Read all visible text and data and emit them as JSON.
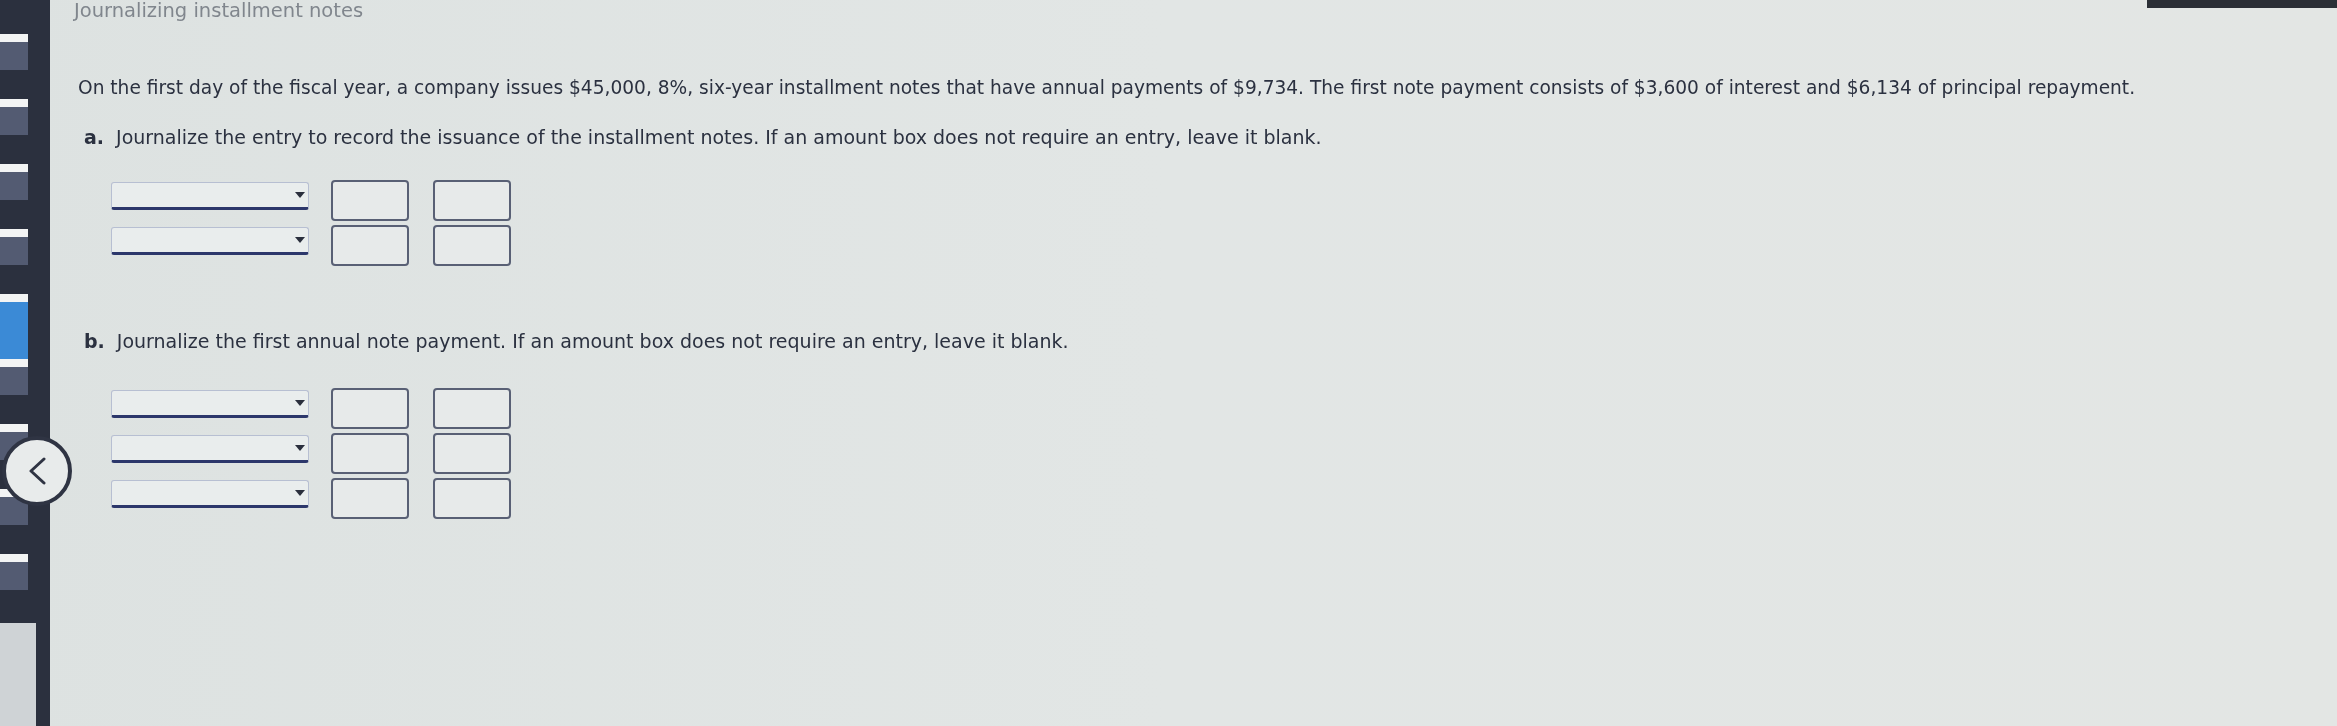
{
  "page_title": "Journalizing installment notes",
  "sidebar": {
    "tabs": [
      {
        "selected": false
      },
      {
        "selected": false
      },
      {
        "selected": false
      },
      {
        "selected": false
      },
      {
        "selected": true
      },
      {
        "selected": false
      },
      {
        "selected": false
      },
      {
        "selected": false
      },
      {
        "selected": false
      }
    ]
  },
  "problem": {
    "statement": "On the first day of the fiscal year, a company issues $45,000, 8%, six-year installment notes that have annual payments of $9,734. The first note payment consists of $3,600 of interest and $6,134 of principal repayment."
  },
  "parts": [
    {
      "label": "a.",
      "prompt": "Journalize the entry to record the issuance of the installment notes. If an amount box does not require an entry, leave it blank.",
      "rows": [
        {
          "kind": "journal_line"
        },
        {
          "kind": "journal_line"
        }
      ]
    },
    {
      "label": "b.",
      "prompt": "Journalize the first annual note payment. If an amount box does not require an entry, leave it blank.",
      "rows": [
        {
          "kind": "journal_line"
        },
        {
          "kind": "journal_line"
        },
        {
          "kind": "journal_line"
        }
      ]
    }
  ]
}
